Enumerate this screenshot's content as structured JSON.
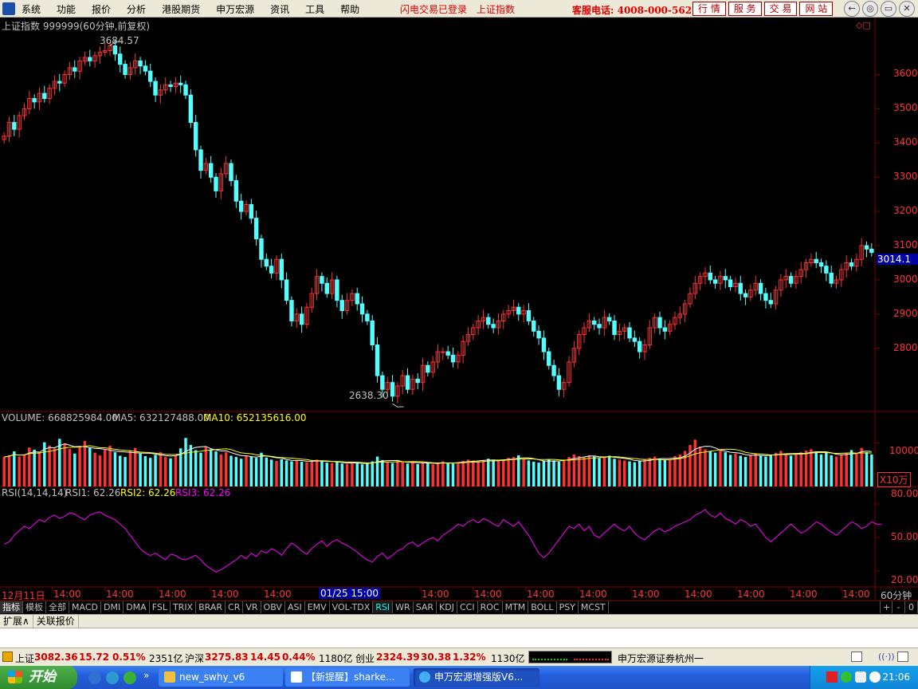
{
  "menubar": {
    "items": [
      "系统",
      "功能",
      "报价",
      "分析",
      "港股期货",
      "申万宏源",
      "资讯",
      "工具",
      "帮助"
    ],
    "status_login": "闪电交易已登录",
    "status_index": "上证指数",
    "hotline": "客服电话: 4008-000-562",
    "nav_buttons": [
      "行 情",
      "服 务",
      "交 易",
      "网 站"
    ],
    "win_controls": [
      "←",
      "◎",
      "▭",
      "✕"
    ]
  },
  "price_panel": {
    "title": "上证指数 999999(60分钟,前复权)",
    "high_label": "3684.57",
    "low_label": "2638.30",
    "current_price_tag": "3014.1",
    "y_ticks": [
      3600,
      3500,
      3400,
      3300,
      3200,
      3100,
      3000,
      2900,
      2800
    ]
  },
  "volume_panel": {
    "label_main": "VOLUME: 668825984.00",
    "label_ma5": "MA5: 632127488.00",
    "label_ma10": "MA10: 652135616.00",
    "y_tick": "10000",
    "unit": "X10万"
  },
  "rsi_panel": {
    "label_main": "RSI(14,14,14)",
    "label_rsi1": "RSI1: 62.26",
    "label_rsi2": "RSI2: 62.26",
    "label_rsi3": "RSI3: 62.26",
    "y_ticks": [
      "80.00",
      "50.00",
      "20.00"
    ]
  },
  "time_axis": {
    "start": "12月11日",
    "cursor": "01/25 15:00",
    "tick": "14:00",
    "period": "60分钟",
    "controls": [
      "+",
      "-",
      "0"
    ]
  },
  "indicators": {
    "items": [
      "指标",
      "模板",
      "全部",
      "MACD",
      "DMI",
      "DMA",
      "FSL",
      "TRIX",
      "BRAR",
      "CR",
      "VR",
      "OBV",
      "ASI",
      "EMV",
      "VOL-TDX",
      "RSI",
      "WR",
      "SAR",
      "KDJ",
      "CCI",
      "ROC",
      "MTM",
      "BOLL",
      "PSY",
      "MCST"
    ],
    "active": "RSI"
  },
  "extbar": {
    "items": [
      "扩展∧",
      "关联报价"
    ]
  },
  "ticker": {
    "sh_name": "上证",
    "sh_price": "3082.36",
    "sh_change": "15.72",
    "sh_pct": "0.51%",
    "sh_amount": "2351亿",
    "hs_name": "沪深",
    "hs_price": "3275.83",
    "hs_change": "14.45",
    "hs_pct": "0.44%",
    "hs_amount": "1180亿",
    "cy_name": "创业",
    "cy_price": "2324.39",
    "cy_change": "30.38",
    "cy_pct": "1.32%",
    "cy_amount": "1130亿",
    "broker": "申万宏源证券杭州一"
  },
  "taskbar": {
    "start_label": "开始",
    "tasks": [
      "new_swhy_v6",
      "【新提醒】sharke...",
      "申万宏源增强版V6..."
    ],
    "clock": "21:06"
  },
  "colors": {
    "up": "#ff3232",
    "down": "#54ffff",
    "ma5": "#ffffff",
    "ma10": "#ffff00",
    "rsi": "#ff00ff",
    "axis": "#800000"
  },
  "chart_data": {
    "type": "candlestick",
    "title": "上证指数 999999(60分钟,前复权)",
    "ylim": [
      2620,
      3720
    ],
    "high": 3684.57,
    "low": 2638.3,
    "last_close": 3014.1,
    "closes": [
      3420,
      3460,
      3440,
      3480,
      3500,
      3530,
      3520,
      3545,
      3530,
      3560,
      3580,
      3575,
      3600,
      3620,
      3610,
      3640,
      3650,
      3640,
      3655,
      3665,
      3670,
      3684,
      3660,
      3630,
      3600,
      3620,
      3640,
      3625,
      3610,
      3580,
      3540,
      3555,
      3570,
      3565,
      3575,
      3570,
      3540,
      3460,
      3380,
      3320,
      3340,
      3300,
      3260,
      3310,
      3340,
      3290,
      3230,
      3200,
      3220,
      3180,
      3120,
      3060,
      3040,
      3020,
      3060,
      3000,
      2940,
      2880,
      2900,
      2870,
      2920,
      2960,
      3010,
      2990,
      2960,
      3000,
      2940,
      2910,
      2940,
      2960,
      2930,
      2900,
      2880,
      2810,
      2720,
      2680,
      2700,
      2660,
      2690,
      2720,
      2680,
      2710,
      2700,
      2750,
      2730,
      2760,
      2790,
      2790,
      2780,
      2760,
      2780,
      2820,
      2840,
      2860,
      2880,
      2890,
      2870,
      2860,
      2880,
      2900,
      2910,
      2920,
      2900,
      2910,
      2880,
      2850,
      2830,
      2790,
      2750,
      2720,
      2680,
      2700,
      2760,
      2800,
      2840,
      2860,
      2880,
      2870,
      2860,
      2890,
      2880,
      2840,
      2850,
      2860,
      2830,
      2820,
      2790,
      2810,
      2860,
      2890,
      2860,
      2850,
      2870,
      2890,
      2900,
      2930,
      2960,
      2990,
      3010,
      3020,
      3000,
      2990,
      3010,
      3000,
      2980,
      2990,
      2960,
      2950,
      2970,
      2990,
      2960,
      2940,
      2930,
      2970,
      3000,
      3010,
      2990,
      3010,
      3030,
      3050,
      3060,
      3050,
      3040,
      3020,
      2990,
      3000,
      3030,
      3050,
      3040,
      3060,
      3100,
      3090,
      3080
    ],
    "volume": [
      6800,
      7200,
      8100,
      6900,
      7400,
      9000,
      8500,
      7800,
      10200,
      9400,
      8800,
      11000,
      9800,
      8700,
      7600,
      9200,
      10500,
      8900,
      7800,
      7200,
      8600,
      9400,
      7900,
      7100,
      6800,
      8200,
      8900,
      7600,
      7000,
      6600,
      7300,
      7900,
      6800,
      6500,
      7100,
      8800,
      11200,
      9600,
      8400,
      7800,
      9200,
      8600,
      8100,
      7400,
      7900,
      7100,
      6800,
      6400,
      7200,
      6900,
      6600,
      7800,
      6700,
      6200,
      5900,
      6300,
      6000,
      5800,
      6100,
      5700,
      5600,
      5900,
      6200,
      5800,
      5500,
      5400,
      5700,
      5300,
      5200,
      5600,
      5400,
      5100,
      5300,
      5800,
      6900,
      6100,
      5700,
      5400,
      5900,
      5600,
      5300,
      5500,
      5200,
      5600,
      5400,
      5100,
      5300,
      5800,
      5500,
      5300,
      5600,
      5900,
      6200,
      6000,
      5800,
      6100,
      6400,
      6200,
      5900,
      6100,
      6600,
      6800,
      7200,
      6400,
      6000,
      5700,
      5500,
      5900,
      6300,
      6000,
      5700,
      6200,
      6800,
      7400,
      7000,
      6700,
      7200,
      6900,
      6500,
      6800,
      7100,
      6400,
      6200,
      6000,
      5800,
      5600,
      5900,
      6200,
      6600,
      6900,
      6400,
      6100,
      6300,
      7000,
      7400,
      8200,
      9600,
      10800,
      9200,
      8600,
      8100,
      7800,
      8400,
      7900,
      7300,
      7600,
      7100,
      6800,
      7200,
      7600,
      7100,
      6900,
      7300,
      7800,
      8200,
      7600,
      7100,
      7400,
      7900,
      8300,
      8600,
      7900,
      7400,
      7800,
      7200,
      6900,
      7300,
      7800,
      8400,
      7700,
      8900,
      7900,
      7400
    ],
    "rsi": [
      44,
      46,
      52,
      56,
      60,
      58,
      62,
      66,
      64,
      68,
      70,
      67,
      69,
      72,
      71,
      68,
      66,
      70,
      72,
      73,
      70,
      68,
      66,
      62,
      58,
      52,
      46,
      40,
      36,
      34,
      36,
      33,
      30,
      35,
      34,
      31,
      30,
      32,
      34,
      30,
      25,
      22,
      19,
      21,
      24,
      27,
      30,
      34,
      31,
      36,
      33,
      38,
      36,
      40,
      38,
      34,
      40,
      45,
      42,
      38,
      35,
      40,
      44,
      47,
      42,
      46,
      48,
      45,
      43,
      40,
      37,
      33,
      30,
      28,
      33,
      36,
      31,
      34,
      38,
      40,
      44,
      46,
      42,
      45,
      48,
      50,
      47,
      52,
      55,
      58,
      62,
      60,
      64,
      66,
      63,
      67,
      65,
      62,
      60,
      66,
      63,
      60,
      64,
      58,
      52,
      44,
      36,
      32,
      36,
      42,
      48,
      54,
      60,
      58,
      62,
      56,
      60,
      52,
      50,
      54,
      58,
      62,
      58,
      56,
      60,
      54,
      50,
      48,
      52,
      56,
      58,
      55,
      57,
      60,
      62,
      64,
      66,
      70,
      72,
      75,
      70,
      68,
      72,
      67,
      65,
      62,
      66,
      64,
      60,
      62,
      56,
      50,
      46,
      50,
      54,
      58,
      62,
      58,
      54,
      56,
      60,
      64,
      62,
      58,
      55,
      52,
      56,
      60,
      64,
      62,
      58,
      60,
      64,
      62,
      62
    ]
  }
}
